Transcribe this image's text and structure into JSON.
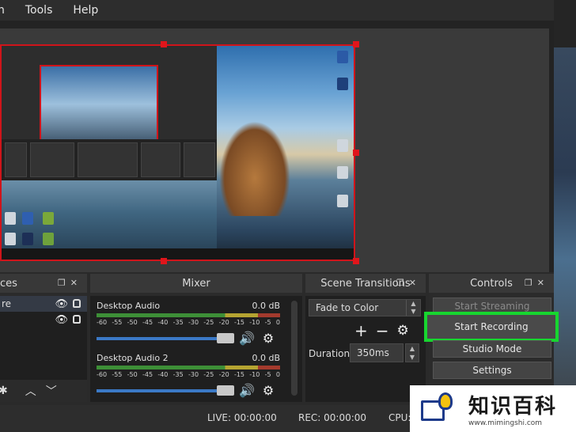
{
  "menu": {
    "items": [
      "n",
      "Tools",
      "Help"
    ]
  },
  "docks": {
    "scenes": {
      "title": "ces",
      "sources": [
        {
          "label": "re"
        },
        {
          "label": ""
        }
      ]
    },
    "mixer": {
      "title": "Mixer",
      "channels": [
        {
          "name": "Desktop Audio",
          "level": "0.0 dB",
          "scale": [
            "-60",
            "-55",
            "-50",
            "-45",
            "-40",
            "-35",
            "-30",
            "-25",
            "-20",
            "-15",
            "-10",
            "-5",
            "0"
          ]
        },
        {
          "name": "Desktop Audio 2",
          "level": "0.0 dB",
          "scale": [
            "-60",
            "-55",
            "-50",
            "-45",
            "-40",
            "-35",
            "-30",
            "-25",
            "-20",
            "-15",
            "-10",
            "-5",
            "0"
          ]
        }
      ]
    },
    "transitions": {
      "title": "Scene Transitions",
      "selected": "Fade to Color",
      "duration_label": "Duration",
      "duration_value": "350ms"
    },
    "controls": {
      "title": "Controls",
      "start_streaming": "Start Streaming",
      "start_recording": "Start Recording",
      "studio_mode": "Studio Mode",
      "settings": "Settings"
    }
  },
  "status": {
    "live": "LIVE: 00:00:00",
    "rec": "REC: 00:00:00",
    "cpu": "CPU:"
  },
  "watermark": {
    "cn": "知识百科",
    "url": "www.mimingshi.com"
  },
  "colors": {
    "selection_border": "#d0141a",
    "highlight": "#17d62f",
    "slider": "#3b79c6"
  }
}
